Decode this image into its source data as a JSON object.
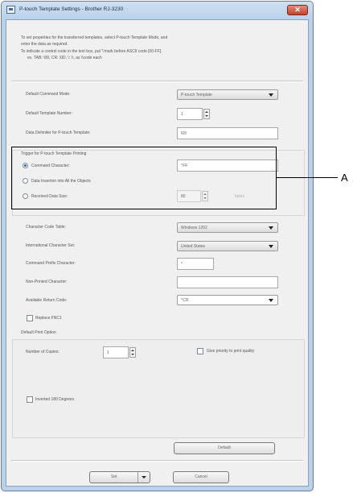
{
  "window": {
    "title": "P-touch Template Settings - Brother RJ-3230",
    "close_label": "✕"
  },
  "description": {
    "line1": "To set properties for the transferred templates, select P-touch Template Mode, and",
    "line2": "enter the data as required.",
    "line3": "To indicate a control code in the text box, put '\\'mark before ASCII code [00-FF].",
    "line4": "ex. TAB: \\09,  CR: \\0D,  \\: \\\\, as \\\\code each"
  },
  "fields": {
    "default_command_mode": {
      "label": "Default Command Mode:",
      "value": "P-touch Template"
    },
    "default_template_number": {
      "label": "Default Template Number:",
      "value": "1"
    },
    "data_delimiter": {
      "label": "Data Delimiter for P-touch Template:",
      "value": "\\09"
    }
  },
  "trigger": {
    "group_label": "Trigger for P-touch Template Printing",
    "command_character": {
      "label": "Command Character:",
      "value": "^FF"
    },
    "data_insertion": {
      "label": "Data Insertion into All the Objects"
    },
    "received_data_size": {
      "label": "Received Data Size:",
      "value": "80",
      "unit": "bytes"
    }
  },
  "settings": {
    "character_code_table": {
      "label": "Character Code Table:",
      "value": "Windows 1252"
    },
    "international_char_set": {
      "label": "International Character Set:",
      "value": "United States"
    },
    "command_prefix": {
      "label": "Command Prefix Character:",
      "value": "^"
    },
    "non_printed": {
      "label": "Non-Printed Character:",
      "value": ""
    },
    "available_return_code": {
      "label": "Available Return Code:",
      "value": "^CR"
    },
    "replace_fnc1": {
      "label": "Replace FNC1"
    }
  },
  "print_option": {
    "group_label": "Default Print Option",
    "copies": {
      "label": "Number of Copies:",
      "value": "1"
    },
    "give_priority": {
      "label": "Give priority to print quality"
    },
    "inverted": {
      "label": "Inverted 180 Degrees"
    }
  },
  "buttons": {
    "default": "Default",
    "set": "Set",
    "cancel": "Cancel"
  },
  "callout": {
    "label": "A"
  }
}
